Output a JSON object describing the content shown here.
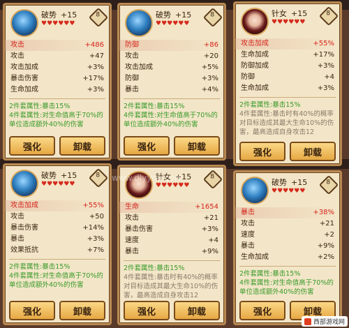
{
  "watermark": "www.dlyyou.com",
  "corner_badge": "西部游戏网",
  "buttons": {
    "upgrade": "强化",
    "unequip": "卸载"
  },
  "cards": [
    {
      "set": "破势",
      "level": "+15",
      "stars": "♥♥♥♥♥♥",
      "avatar": "breaking-soul-icon",
      "main": {
        "name": "攻击",
        "value": "+486"
      },
      "subs": [
        {
          "name": "攻击",
          "value": "+47"
        },
        {
          "name": "攻击加成",
          "value": "+3%"
        },
        {
          "name": "暴击伤害",
          "value": "+17%"
        },
        {
          "name": "生命加成",
          "value": "+3%"
        }
      ],
      "set2": "2件套属性:暴击15%",
      "set4": "4件套属性:对生命值高于70%的单位造成额外40%的伤害"
    },
    {
      "set": "破势",
      "level": "+15",
      "stars": "♥♥♥♥♥♥",
      "avatar": "breaking-soul-icon",
      "main": {
        "name": "防御",
        "value": "+86"
      },
      "subs": [
        {
          "name": "攻击",
          "value": "+20"
        },
        {
          "name": "攻击加成",
          "value": "+5%"
        },
        {
          "name": "防御",
          "value": "+3%"
        },
        {
          "name": "暴击",
          "value": "+4%"
        }
      ],
      "set2": "2件套属性:暴击15%",
      "set4": "4件套属性:对生命值高于70%的单位造成额外40%的伤害"
    },
    {
      "set": "针女",
      "level": "+15",
      "stars": "♥♥♥♥♥♥",
      "avatar": "needle-woman-icon",
      "main": {
        "name": "攻击加成",
        "value": "+55%"
      },
      "subs": [
        {
          "name": "生命加成",
          "value": "+17%"
        },
        {
          "name": "防御加成",
          "value": "+3%"
        },
        {
          "name": "防御",
          "value": "+4"
        },
        {
          "name": "生命加成",
          "value": "+3%"
        }
      ],
      "set2": "2件套属性:暴击15%",
      "set4": "4件套属性:暴击时有40%的概率对目标造成其最大生命10%的伤害，最高造成自身攻击12"
    },
    {
      "set": "破势",
      "level": "+15",
      "stars": "♥♥♥♥♥♥",
      "avatar": "breaking-soul-icon",
      "main": {
        "name": "攻击加成",
        "value": "+55%"
      },
      "subs": [
        {
          "name": "攻击",
          "value": "+50"
        },
        {
          "name": "暴击伤害",
          "value": "+14%"
        },
        {
          "name": "暴击",
          "value": "+3%"
        },
        {
          "name": "效果抵抗",
          "value": "+7%"
        }
      ],
      "set2": "2件套属性:暴击15%",
      "set4": "4件套属性:对生命值高于70%的单位造成额外40%的伤害"
    },
    {
      "set": "针女",
      "level": "+15",
      "stars": "♥♥♥♥♥♥",
      "avatar": "needle-woman-icon",
      "main": {
        "name": "生命",
        "value": "+1654"
      },
      "subs": [
        {
          "name": "攻击",
          "value": "+21"
        },
        {
          "name": "暴击伤害",
          "value": "+3%"
        },
        {
          "name": "速度",
          "value": "+4"
        },
        {
          "name": "暴击",
          "value": "+9%"
        }
      ],
      "set2": "2件套属性:暴击15%",
      "set4": "4件套属性:暴击时有40%的概率对目标造成其最大生命10%的伤害，最高造成自身攻击12"
    },
    {
      "set": "破势",
      "level": "+15",
      "stars": "♥♥♥♥♥♥",
      "avatar": "breaking-soul-icon",
      "main": {
        "name": "暴击",
        "value": "+38%"
      },
      "subs": [
        {
          "name": "攻击",
          "value": "+21"
        },
        {
          "name": "速度",
          "value": "+2"
        },
        {
          "name": "暴击",
          "value": "+9%"
        },
        {
          "name": "生命加成",
          "value": "+2%"
        }
      ],
      "set2": "2件套属性:暴击15%",
      "set4": "4件套属性:对生命值高于70%的单位造成额外40%的伤害"
    }
  ]
}
